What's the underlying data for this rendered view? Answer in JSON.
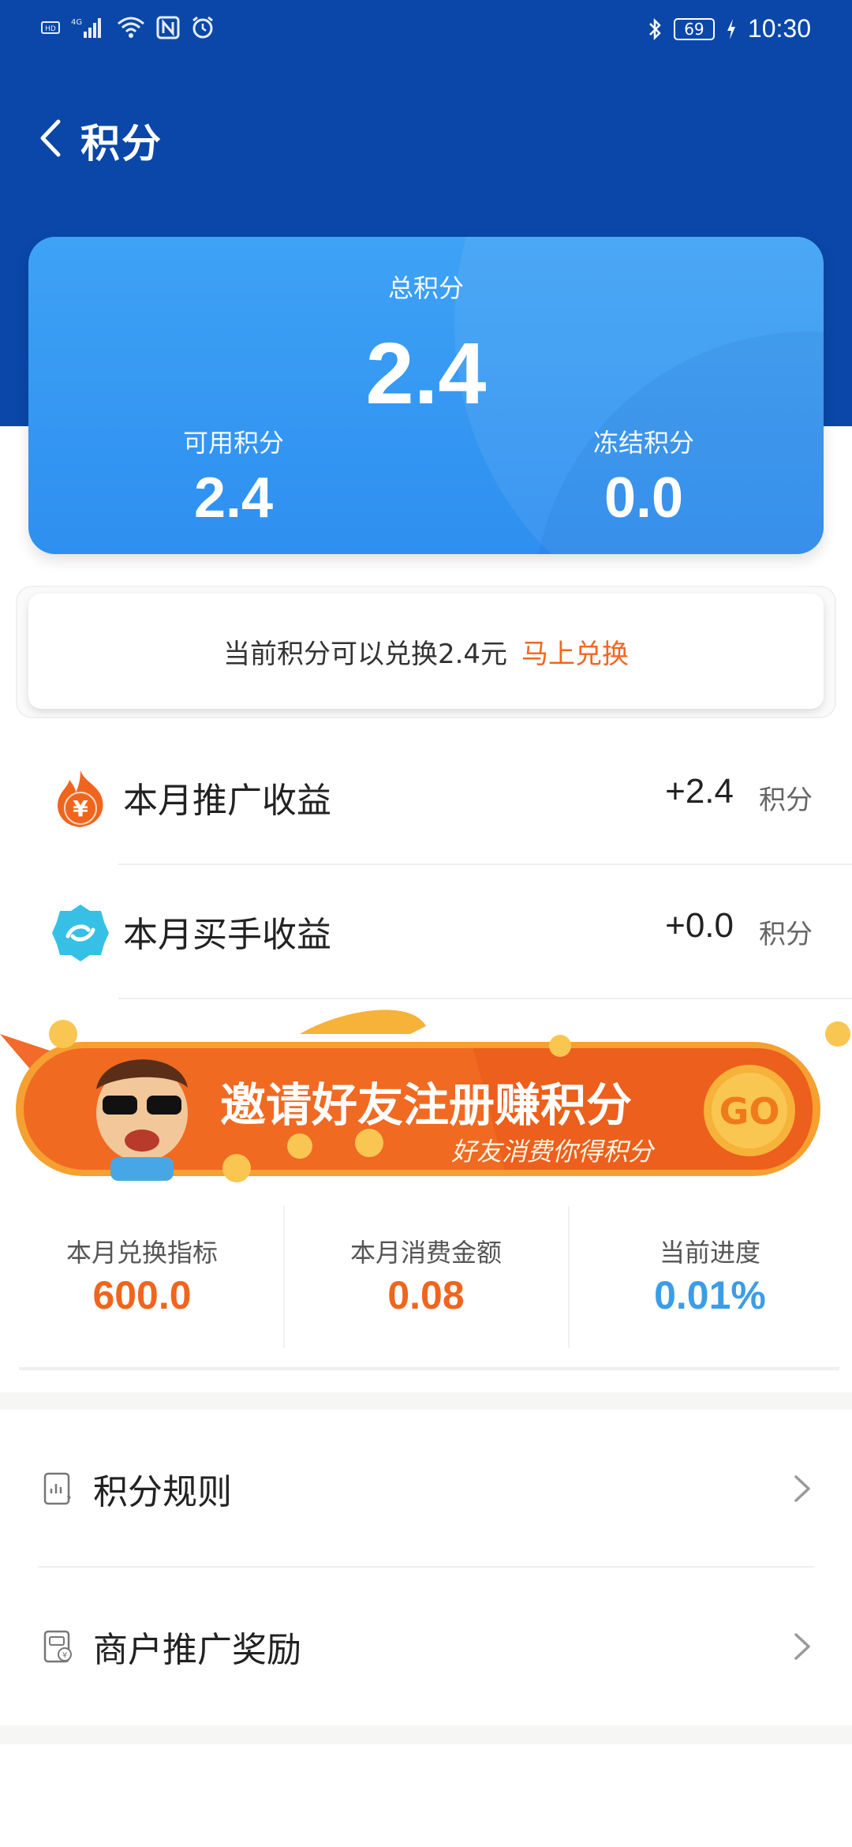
{
  "status_bar": {
    "time": "10:30",
    "battery": "69",
    "left_icons": [
      "hd-icon",
      "signal-4g-icon",
      "wifi-icon",
      "nfc-icon",
      "alarm-icon"
    ],
    "right_icons": [
      "bluetooth-icon",
      "battery-icon",
      "charging-icon"
    ]
  },
  "header": {
    "title": "积分"
  },
  "points_card": {
    "total_label": "总积分",
    "total_value": "2.4",
    "available_label": "可用积分",
    "available_value": "2.4",
    "frozen_label": "冻结积分",
    "frozen_value": "0.0"
  },
  "exchange": {
    "text": "当前积分可以兑换2.4元",
    "link": "马上兑换"
  },
  "earnings": [
    {
      "label": "本月推广收益",
      "value": "+2.4",
      "unit": "积分",
      "icon": "fire-yuan-icon"
    },
    {
      "label": "本月买手收益",
      "value": "+0.0",
      "unit": "积分",
      "icon": "buyer-badge-icon"
    }
  ],
  "banner": {
    "title": "邀请好友注册赚积分",
    "subtitle": "好友消费你得积分",
    "go_label": "GO"
  },
  "stats": [
    {
      "label": "本月兑换指标",
      "value": "600.0",
      "color": "#f0651e"
    },
    {
      "label": "本月消费金额",
      "value": "0.08",
      "color": "#f0651e"
    },
    {
      "label": "当前进度",
      "value": "0.01%",
      "color": "#3b9de8"
    }
  ],
  "menu": [
    {
      "label": "积分规则",
      "icon": "rules-doc-icon"
    },
    {
      "label": "商户推广奖励",
      "icon": "merchant-reward-icon"
    }
  ],
  "colors": {
    "header_bg": "#0a47a8",
    "card_bg": "#3a9cf4",
    "accent_orange": "#f5651e",
    "accent_blue": "#3b9de8"
  }
}
